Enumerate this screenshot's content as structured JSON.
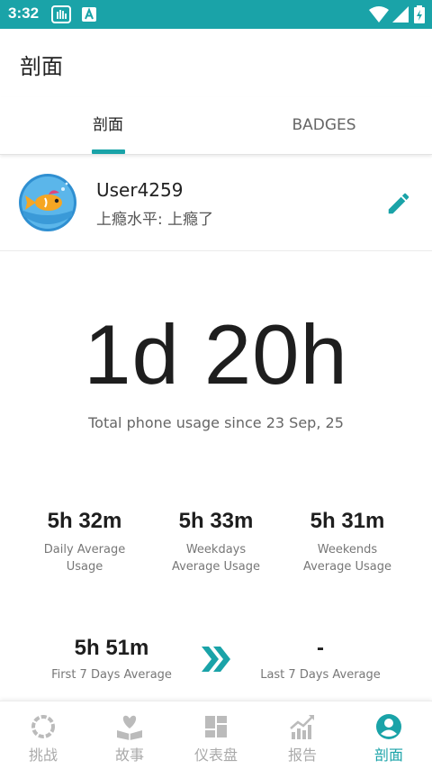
{
  "status_bar": {
    "time": "3:32"
  },
  "app_bar": {
    "title": "剖面"
  },
  "tabs": [
    {
      "label": "剖面",
      "active": true
    },
    {
      "label": "BADGES",
      "active": false
    }
  ],
  "profile": {
    "username": "User4259",
    "addiction_level": "上瘾水平: 上瘾了"
  },
  "usage": {
    "total": "1d 20h",
    "caption": "Total phone usage since 23 Sep, 25"
  },
  "stats": [
    {
      "value": "5h 32m",
      "label_line1": "Daily Average",
      "label_line2": "Usage"
    },
    {
      "value": "5h 33m",
      "label_line1": "Weekdays",
      "label_line2": "Average Usage"
    },
    {
      "value": "5h 31m",
      "label_line1": "Weekends",
      "label_line2": "Average Usage"
    }
  ],
  "comparison": {
    "first": {
      "value": "5h 51m",
      "label": "First 7 Days Average"
    },
    "last": {
      "value": "-",
      "label": "Last 7 Days Average"
    }
  },
  "bottom_nav": [
    {
      "label": "挑战",
      "icon": "challenge-icon"
    },
    {
      "label": "故事",
      "icon": "story-icon"
    },
    {
      "label": "仪表盘",
      "icon": "dashboard-icon"
    },
    {
      "label": "报告",
      "icon": "report-icon"
    },
    {
      "label": "剖面",
      "icon": "profile-icon",
      "active": true
    }
  ],
  "colors": {
    "accent": "#1aa3a8",
    "text": "#222222",
    "muted": "#aaaaaa"
  }
}
